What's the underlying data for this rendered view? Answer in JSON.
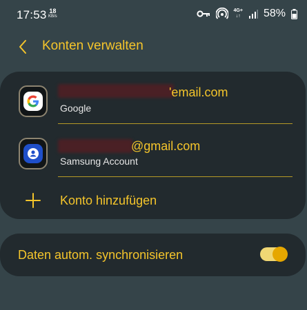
{
  "status_bar": {
    "time": "17:53",
    "speed_value": "18",
    "speed_unit": "KB/s",
    "network_type_top": "4G+",
    "battery": "58%",
    "icons": [
      "vpn-key-icon",
      "hotspot-icon",
      "signal-icon",
      "battery-icon"
    ]
  },
  "header": {
    "back_icon": "chevron-left-icon",
    "title": "Konten verwalten"
  },
  "accounts": [
    {
      "email_visible": "'email.com",
      "provider": "Google",
      "icon": "google-icon"
    },
    {
      "email_visible": "@gmail.com",
      "provider": "Samsung Account",
      "icon": "samsung-account-icon"
    }
  ],
  "add_account": {
    "label": "Konto hinzufügen",
    "icon": "plus-icon"
  },
  "sync": {
    "label": "Daten autom. synchronisieren",
    "enabled": true
  },
  "colors": {
    "background": "#354449",
    "card": "#222a2e",
    "accent": "#f5c52b",
    "divider": "#b79a26"
  }
}
